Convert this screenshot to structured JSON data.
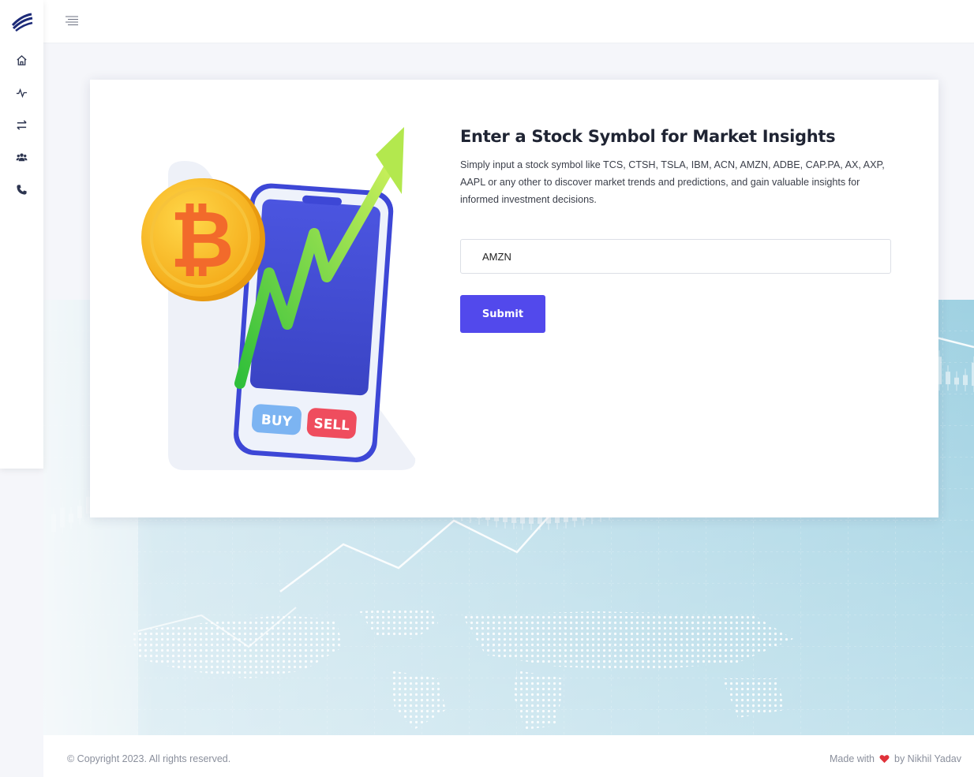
{
  "sidebar": {
    "logo": "brand-logo",
    "items": [
      {
        "name": "home",
        "icon": "home-icon"
      },
      {
        "name": "activity",
        "icon": "pulse-icon"
      },
      {
        "name": "transfer",
        "icon": "exchange-icon"
      },
      {
        "name": "users",
        "icon": "users-icon"
      },
      {
        "name": "contact",
        "icon": "phone-icon"
      }
    ]
  },
  "topbar": {
    "menu_icon": "menu-icon"
  },
  "card": {
    "title": "Enter a Stock Symbol for Market Insights",
    "description": "Simply input a stock symbol like TCS, CTSH, TSLA, IBM, ACN, AMZN, ADBE, CAP.PA, AX, AXP, AAPL or any other to discover market trends and predictions, and gain valuable insights for informed investment decisions.",
    "input_value": "AMZN",
    "submit_label": "Submit",
    "illustration": {
      "buy_label": "BUY",
      "sell_label": "SELL"
    }
  },
  "footer": {
    "copyright": "© Copyright 2023. All rights reserved.",
    "made_with": "Made with",
    "by": "by Nikhil Yadav"
  },
  "colors": {
    "accent": "#5249ec",
    "heart": "#e0323a",
    "sidebar_icon": "#2d3550"
  }
}
